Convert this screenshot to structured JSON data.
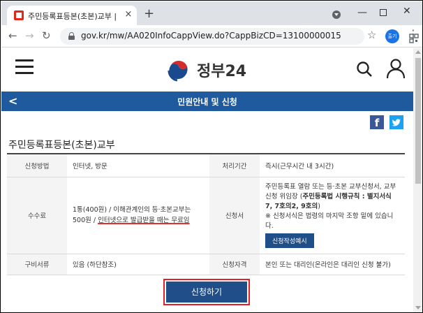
{
  "browser": {
    "tab_title": "주민등록표등본(초본)교부 | 민원",
    "tab_close": "×",
    "new_tab": "+",
    "url": "gov.kr/mw/AA020InfoCappView.do?CappBizCD=13100000015",
    "profile_label": "출기",
    "window_min": "—",
    "window_close": "✕"
  },
  "site": {
    "logo_text": "정부24"
  },
  "titlebar": {
    "back": "<",
    "title": "민원안내 및 신청"
  },
  "share": {
    "facebook": "f"
  },
  "page": {
    "title": "주민등록표등본(초본)교부"
  },
  "info_table": {
    "method_label": "신청방법",
    "method_value": "인터넷, 방문",
    "period_label": "처리기간",
    "period_value": "즉시(근무시간 내 3시간)",
    "fee_label": "수수료",
    "fee_value_a": "1통(400원) / 이해관계인의 등·초본교부는 500원 / ",
    "fee_value_b": "인터넷으로 발급받을 때는 무료임",
    "form_label": "신청서",
    "form_text_a": "주민등록표 열람 또는 등·초본 교부신청서, 교부신청 위임장 (",
    "form_text_bold": "주민등록법 시행규칙 : 별지서식 7, 7호의2, 9호의",
    "form_text_b": ")",
    "form_note": "※ 신청서식은 법령의 마지막 조항 밑에 있습니다.",
    "form_example_button": "신청작성예시",
    "docs_label": "구비서류",
    "docs_value": "있음 (하단참조)",
    "eligibility_label": "신청자격",
    "eligibility_value": "본인 또는 대리인(온라인은 대리인 신청 불가)"
  },
  "apply_button": "신청하기",
  "colors": {
    "brand_blue": "#1f5a9e",
    "button_blue": "#1f4e89",
    "highlight_red": "#e0202a"
  }
}
